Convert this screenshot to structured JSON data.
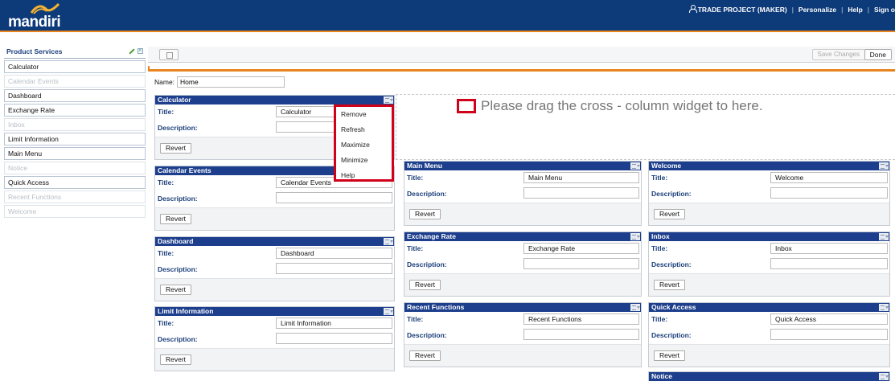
{
  "header": {
    "logo_text": "mandiri",
    "user_label": "TRADE PROJECT (MAKER)",
    "personalize": "Personalize",
    "help": "Help",
    "sign_out": "Sign o",
    "separator": "|"
  },
  "sidebar": {
    "title": "Product Services",
    "items": [
      {
        "label": "Calculator",
        "enabled": true
      },
      {
        "label": "Calendar Events",
        "enabled": false
      },
      {
        "label": "Dashboard",
        "enabled": true
      },
      {
        "label": "Exchange Rate",
        "enabled": true
      },
      {
        "label": "Inbox",
        "enabled": false
      },
      {
        "label": "Limit Information",
        "enabled": true
      },
      {
        "label": "Main Menu",
        "enabled": true
      },
      {
        "label": "Notice",
        "enabled": false
      },
      {
        "label": "Quick Access",
        "enabled": true
      },
      {
        "label": "Recent Functions",
        "enabled": false
      },
      {
        "label": "Welcome",
        "enabled": false
      }
    ]
  },
  "toolbar": {
    "save_label": "Save Changes",
    "done_label": "Done"
  },
  "page": {
    "name_label": "Name:",
    "name_value": "Home"
  },
  "drop_zone": {
    "text": "Please drag the cross - column widget to here."
  },
  "labels": {
    "title": "Title:",
    "description": "Description:",
    "revert": "Revert"
  },
  "widgets": {
    "calculator": {
      "header": "Calculator",
      "title_value": "Calculator"
    },
    "calendar_events": {
      "header": "Calendar Events",
      "title_value": "Calendar Events"
    },
    "dashboard": {
      "header": "Dashboard",
      "title_value": "Dashboard"
    },
    "limit_information": {
      "header": "Limit Information",
      "title_value": "Limit Information"
    },
    "main_menu": {
      "header": "Main Menu",
      "title_value": "Main Menu"
    },
    "welcome": {
      "header": "Welcome",
      "title_value": "Welcome"
    },
    "exchange_rate": {
      "header": "Exchange Rate",
      "title_value": "Exchange Rate"
    },
    "inbox": {
      "header": "Inbox",
      "title_value": "Inbox"
    },
    "recent_functions": {
      "header": "Recent Functions",
      "title_value": "Recent Functions"
    },
    "quick_access": {
      "header": "Quick Access",
      "title_value": "Quick Access"
    },
    "notice": {
      "header": "Notice"
    }
  },
  "context_menu": {
    "items": [
      "Remove",
      "Refresh",
      "Maximize",
      "Minimize",
      "Help"
    ]
  },
  "colors": {
    "header_bg": "#0d3a78",
    "accent_orange": "#e8841e",
    "widget_header": "#1c3e8c",
    "highlight_red": "#d0021b"
  }
}
